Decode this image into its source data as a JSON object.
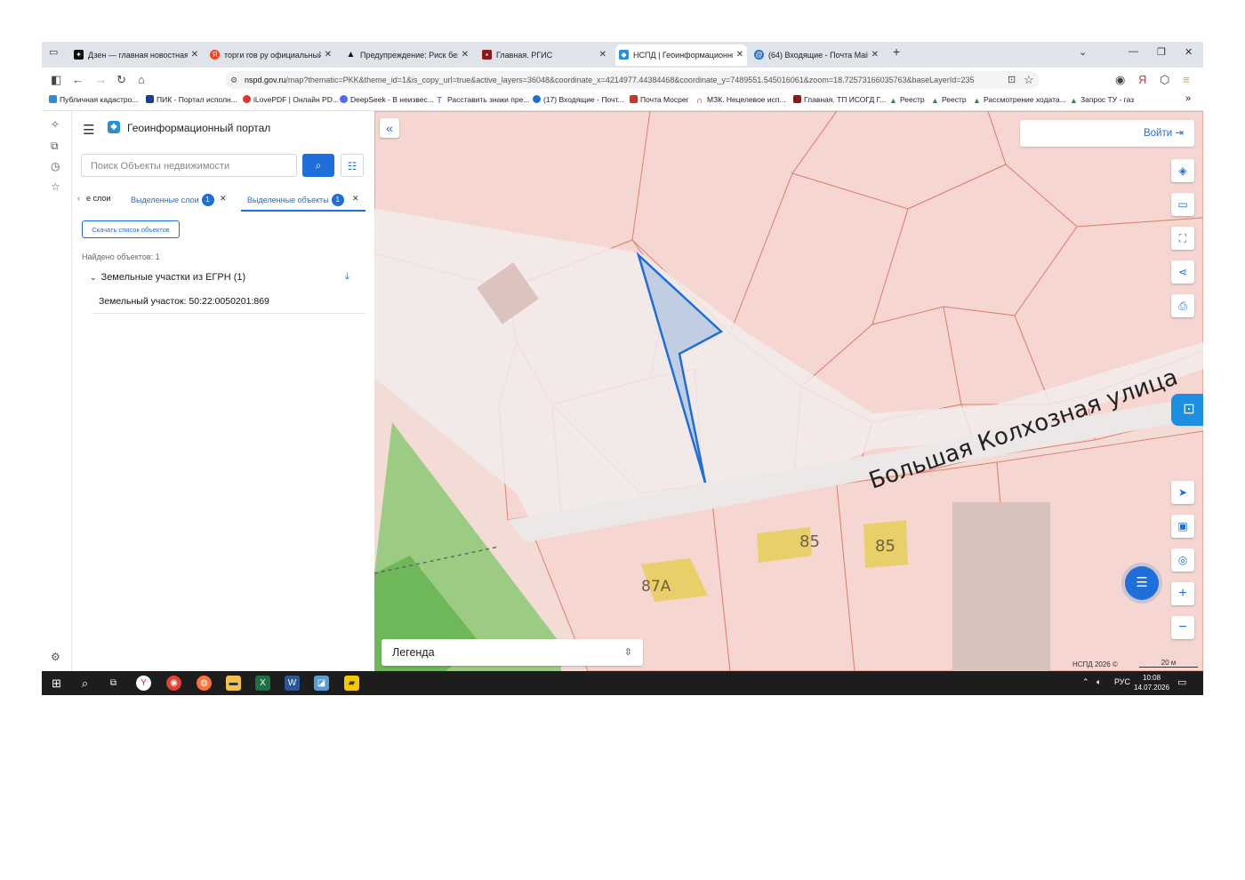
{
  "browser": {
    "tabs": [
      {
        "label": "Дзен — главная новостная ин",
        "icon": "dzen-icon",
        "color": "#111111"
      },
      {
        "label": "торги гов ру официальный са",
        "icon": "yandex-icon",
        "color": "#fc3f1d"
      },
      {
        "label": "Предупреждение: Риск безопа",
        "icon": "warning-icon",
        "color": "#222222"
      },
      {
        "label": "Главная. РГИС",
        "icon": "rgis-icon",
        "color": "#8b1a1a"
      },
      {
        "label": "НСПД | Геоинформационный",
        "icon": "nspd-icon",
        "color": "#2a8fd6"
      },
      {
        "label": "(64) Входящие - Почта Mail",
        "icon": "mail-icon",
        "color": "#1e6fd9"
      }
    ],
    "address": {
      "host": "nspd.gov.ru",
      "path": "/map?thematic=PKK&theme_id=1&is_copy_url=true&active_layers=36048&coordinate_x=4214977.44384468&coordinate_y=7489551.545016061&zoom=18.72573166035763&baseLayerId=235"
    },
    "bookmarks": [
      {
        "label": "Публичная кадастро...",
        "color": "#2a8fd6"
      },
      {
        "label": "ПИК - Портал исполн...",
        "color": "#1b3f8b"
      },
      {
        "label": "iLovePDF | Онлайн PD...",
        "color": "#e5322d"
      },
      {
        "label": "DeepSeek - В неизвес...",
        "color": "#4d6bfe"
      },
      {
        "label": "Расставить знаки пре...",
        "color": "#2a6ad6"
      },
      {
        "label": "(17) Входящие - Почт...",
        "color": "#1e6fd9"
      },
      {
        "label": "Почта Мосрег",
        "color": "#c0392b"
      },
      {
        "label": "МЗК. Нецелевое исп...",
        "color": "#b22222"
      },
      {
        "label": "Главная. ТП ИСОГД Г...",
        "color": "#8b1a1a"
      },
      {
        "label": "Реестр",
        "color": "#2e8b57"
      },
      {
        "label": "Реестр",
        "color": "#2e8b57"
      },
      {
        "label": "Рассмотрение ходата...",
        "color": "#2e8b57"
      },
      {
        "label": "Запрос ТУ - газ",
        "color": "#2e8b57"
      }
    ]
  },
  "panel": {
    "title": "Геоинформационный портал",
    "search_placeholder": "Поиск Объекты недвижимости",
    "tabs": {
      "layers": "е слои",
      "selected_layers": "Выделенные слои",
      "selected_layers_count": "1",
      "selected_objects": "Выделенные объекты",
      "selected_objects_count": "1"
    },
    "download_button": "Скачать список объектов",
    "found": "Найдено объектов: 1",
    "group": "Земельные участки из ЕГРН (1)",
    "parcel": "Земельный участок: 50:22:0050201:869"
  },
  "map": {
    "login": "Войти",
    "legend": "Легенда",
    "copyright": "НСПД 2026 ©",
    "scale": "20 м",
    "street": "Большая Колхозная улица",
    "house_numbers": [
      "85",
      "85",
      "87А"
    ],
    "colors": {
      "parcel_fill": "#f5d6d0",
      "parcel_line": "#e08070",
      "selected": "#1e6fd9",
      "green": "#7cc36a",
      "building": "#e8cf6a"
    }
  },
  "taskbar": {
    "language": "РУС",
    "time": "10:08",
    "date": "14.07.2026"
  }
}
